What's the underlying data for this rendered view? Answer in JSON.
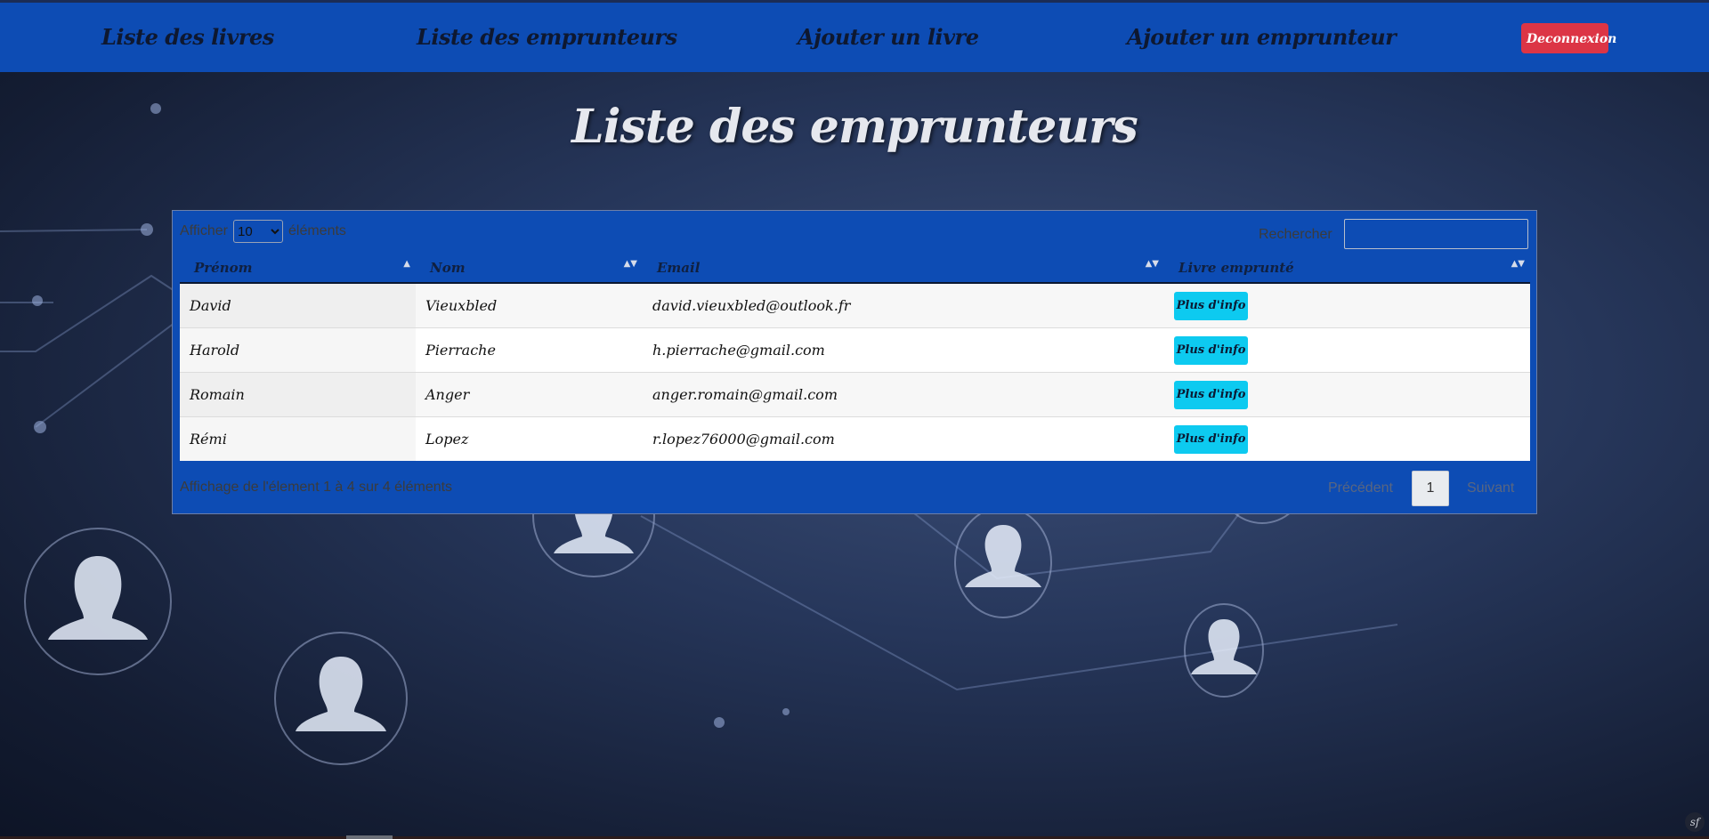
{
  "nav": {
    "links": [
      {
        "label": "Liste des livres"
      },
      {
        "label": "Liste des emprunteurs"
      },
      {
        "label": "Ajouter un livre"
      },
      {
        "label": "Ajouter un emprunteur"
      }
    ],
    "logout_label": "Deconnexion"
  },
  "page": {
    "title": "Liste des emprunteurs"
  },
  "table_controls": {
    "show_label": "Afficher",
    "page_length_selected": "10",
    "elements_label": "éléments",
    "search_label": "Rechercher",
    "search_value": ""
  },
  "table": {
    "columns": [
      {
        "label": "Prénom",
        "sort": "▲"
      },
      {
        "label": "Nom",
        "sort": "▲▼"
      },
      {
        "label": "Email",
        "sort": "▲▼"
      },
      {
        "label": "Livre emprunté",
        "sort": "▲▼"
      }
    ],
    "rows": [
      {
        "prenom": "David",
        "nom": "Vieuxbled",
        "email": "david.vieuxbled@outlook.fr",
        "action": "Plus d'info"
      },
      {
        "prenom": "Harold",
        "nom": "Pierrache",
        "email": "h.pierrache@gmail.com",
        "action": "Plus d'info"
      },
      {
        "prenom": "Romain",
        "nom": "Anger",
        "email": "anger.romain@gmail.com",
        "action": "Plus d'info"
      },
      {
        "prenom": "Rémi",
        "nom": "Lopez",
        "email": "r.lopez76000@gmail.com",
        "action": "Plus d'info"
      }
    ]
  },
  "footer": {
    "info": "Affichage de l'élement 1 à 4 sur 4 éléments",
    "prev_label": "Précédent",
    "current_page": "1",
    "next_label": "Suivant"
  },
  "colors": {
    "navbar": "#0d4cb4",
    "logout": "#dc3545",
    "info_button": "#0dcaf0"
  },
  "icons": {
    "symfony_badge": "symfony-icon",
    "sort": "sort-arrows-icon"
  }
}
